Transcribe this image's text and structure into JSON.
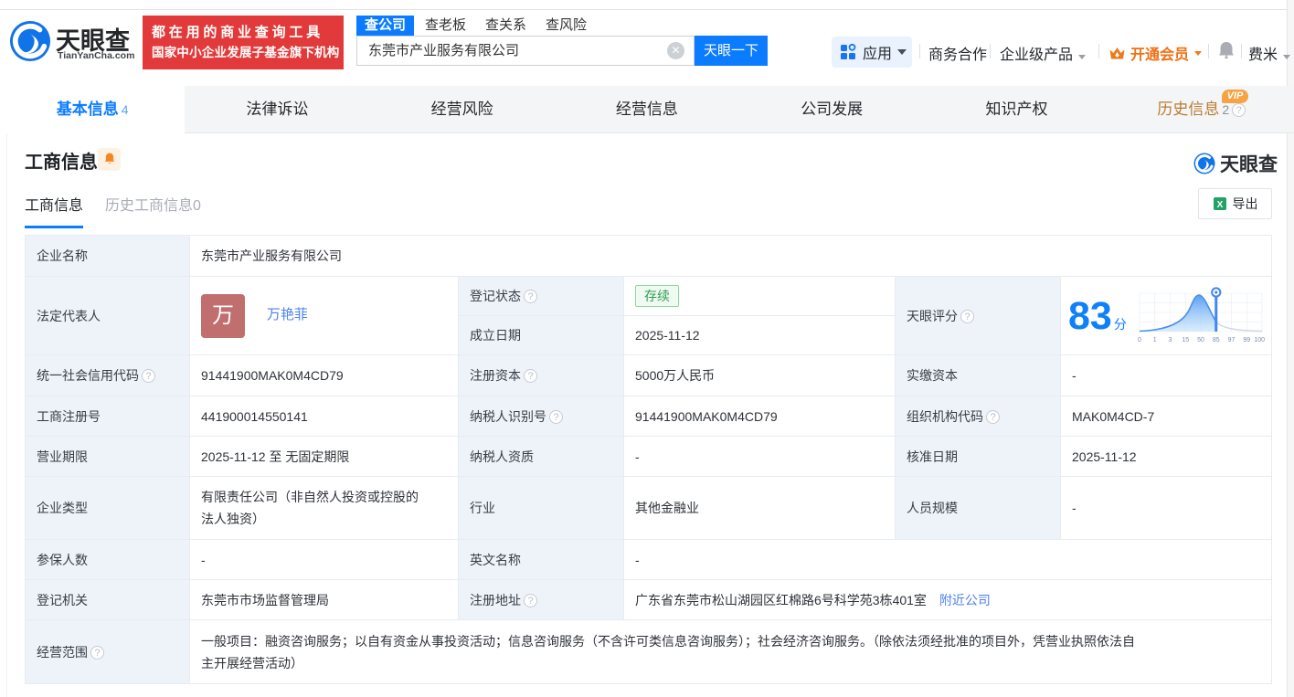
{
  "header": {
    "logo_title": "天眼查",
    "logo_domain": "TianYanCha.com",
    "banner_line1": "都在用的商业查询工具",
    "banner_line2": "国家中小企业发展子基金旗下机构",
    "search_tabs": [
      {
        "label": "查公司"
      },
      {
        "label": "查老板"
      },
      {
        "label": "查关系"
      },
      {
        "label": "查风险"
      }
    ],
    "search_value": "东莞市产业服务有限公司",
    "search_button": "天眼一下",
    "app_label": "应用",
    "coop_label": "商务合作",
    "enterprise_label": "企业级产品",
    "vip_label": "开通会员",
    "user_label": "费米"
  },
  "tabs": [
    {
      "label": "基本信息",
      "count": "4"
    },
    {
      "label": "法律诉讼"
    },
    {
      "label": "经营风险"
    },
    {
      "label": "经营信息"
    },
    {
      "label": "公司发展"
    },
    {
      "label": "知识产权"
    },
    {
      "label": "历史信息",
      "count": "2",
      "vip": "VIP"
    }
  ],
  "section": {
    "title": "工商信息",
    "watermark": "天眼查",
    "subtab_active": "工商信息",
    "subtab_history": "历史工商信息0",
    "export_label": "导出"
  },
  "fields": {
    "company_name": {
      "label": "企业名称",
      "value": "东莞市产业服务有限公司"
    },
    "legal_rep": {
      "label": "法定代表人",
      "avatar": "万",
      "value": "万艳菲"
    },
    "reg_status": {
      "label": "登记状态",
      "value": "存续"
    },
    "est_date": {
      "label": "成立日期",
      "value": "2025-11-12"
    },
    "score": {
      "label": "天眼评分",
      "value": "83",
      "unit": "分"
    },
    "credit_code": {
      "label": "统一社会信用代码",
      "value": "91441900MAK0M4CD79"
    },
    "reg_capital": {
      "label": "注册资本",
      "value": "5000万人民币"
    },
    "paid_capital": {
      "label": "实缴资本",
      "value": "-"
    },
    "reg_number": {
      "label": "工商注册号",
      "value": "441900014550141"
    },
    "taxpayer_id": {
      "label": "纳税人识别号",
      "value": "91441900MAK0M4CD79"
    },
    "org_code": {
      "label": "组织机构代码",
      "value": "MAK0M4CD-7"
    },
    "business_term": {
      "label": "营业期限",
      "value": "2025-11-12 至 无固定期限"
    },
    "taxpayer_qualification": {
      "label": "纳税人资质",
      "value": "-"
    },
    "approval_date": {
      "label": "核准日期",
      "value": "2025-11-12"
    },
    "company_type": {
      "label": "企业类型",
      "value": "有限责任公司（非自然人投资或控股的法人独资）"
    },
    "industry": {
      "label": "行业",
      "value": "其他金融业"
    },
    "staff_size": {
      "label": "人员规模",
      "value": "-"
    },
    "insured_count": {
      "label": "参保人数",
      "value": "-"
    },
    "english_name": {
      "label": "英文名称",
      "value": "-"
    },
    "reg_authority": {
      "label": "登记机关",
      "value": "东莞市市场监督管理局"
    },
    "reg_address": {
      "label": "注册地址",
      "value": "广东省东莞市松山湖园区红棉路6号科学苑3栋401室",
      "link": "附近公司"
    },
    "business_scope": {
      "label": "经营范围",
      "value": "一般项目：融资咨询服务；以自有资金从事投资活动；信息咨询服务（不含许可类信息咨询服务）；社会经济咨询服务。（除依法须经批准的项目外，凭营业执照依法自主开展经营活动）"
    }
  },
  "score_chart": {
    "type": "area",
    "marker_value": 85,
    "axis": [
      "0",
      "1",
      "3",
      "15",
      "50",
      "85",
      "97",
      "99",
      "100"
    ]
  }
}
